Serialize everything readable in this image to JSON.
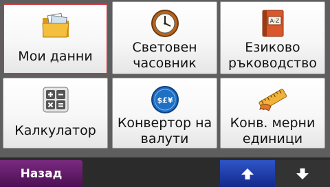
{
  "tiles": [
    {
      "label": "Мои данни",
      "icon": "folder-icon",
      "selected": true
    },
    {
      "label": "Световен часовник",
      "icon": "clock-icon"
    },
    {
      "label": "Езиково ръководство",
      "icon": "dictionary-book-icon",
      "icon_text": "A-Z"
    },
    {
      "label": "Калкулатор",
      "icon": "calculator-icon"
    },
    {
      "label": "Конвертор на валути",
      "icon": "currency-icon",
      "icon_text": "$£¥"
    },
    {
      "label": "Конв. мерни единици",
      "icon": "ruler-icon"
    }
  ],
  "bottombar": {
    "back_label": "Назад",
    "up_icon": "arrow-up-icon",
    "down_icon": "arrow-down-icon"
  },
  "colors": {
    "selection": "#d2323a",
    "back_button": "#5a1a62",
    "up_button": "#1e3fb0"
  }
}
